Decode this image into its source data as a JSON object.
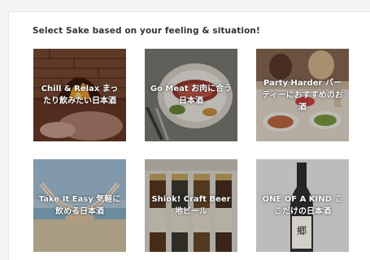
{
  "heading": "Select Sake based on your feeling & situation!",
  "tiles": [
    {
      "label": "Chill & Relax まったり飲みたい日本酒"
    },
    {
      "label": "Go Meat お肉に合う日本酒"
    },
    {
      "label": "Party Harder パーティーにおすすめのお酒"
    },
    {
      "label": "Take It Easy 気軽に飲める日本酒"
    },
    {
      "label": "Shiok! Craft Beer 地ビール"
    },
    {
      "label": "ONE OF A KIND ここだけの日本酒"
    }
  ]
}
